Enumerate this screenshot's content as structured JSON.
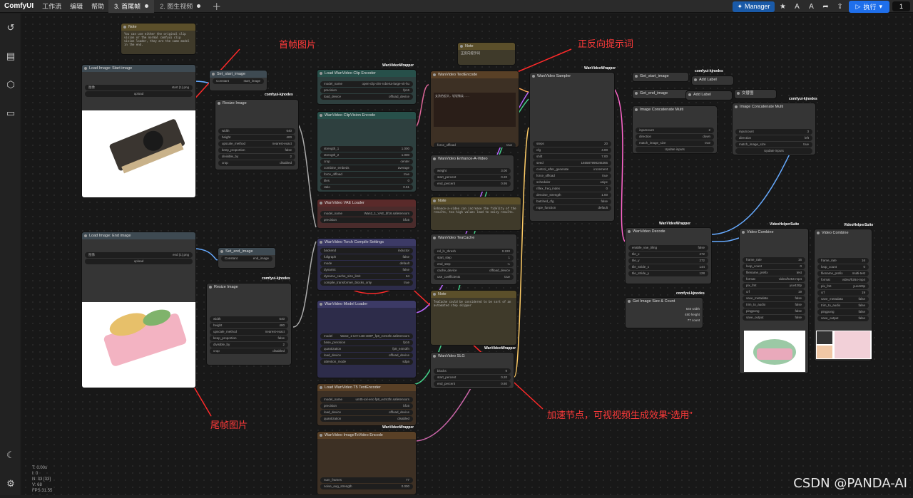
{
  "app": {
    "logo": "ComfyUI",
    "menus": [
      "工作流",
      "编辑",
      "帮助"
    ]
  },
  "tabs": [
    {
      "label": "3. 首尾帧",
      "active": true
    },
    {
      "label": "2. 图生视频",
      "active": false
    }
  ],
  "toolbar": {
    "manager": "Manager",
    "run": "执行",
    "count": "1"
  },
  "annotations": {
    "first": "首帧图片",
    "prompt": "正反向提示词",
    "last": "尾帧图片",
    "accel": "加速节点，可视视频生成效果“选用”"
  },
  "watermark": "CSDN @PANDA-AI",
  "stats": [
    "T: 0.00s",
    "I: 0",
    "N: 33 [33]",
    "V: 68",
    "FPS:31.55"
  ],
  "nodes": {
    "note1": {
      "title": "Note",
      "text": "You can use either the original clip vision or the normal comfyui clip vision loader, they are the same model in the end."
    },
    "load_start": {
      "title": "Load Image: Start image",
      "file": "start (1).png",
      "upload": "upload"
    },
    "load_end": {
      "title": "Load Image: End image",
      "file": "end (1).png",
      "upload": "upload"
    },
    "set_start": {
      "title": "Set_start_image",
      "const": "Constant",
      "val": "start_image"
    },
    "set_end": {
      "title": "Set_end_image",
      "const": "Constant",
      "val": "end_image"
    },
    "resize1": {
      "title": "Resize Image",
      "rows": [
        [
          "width",
          "640"
        ],
        [
          "height",
          "400"
        ],
        [
          "upscale_method",
          "nearest-exact"
        ],
        [
          "keep_proportion",
          "false"
        ],
        [
          "divisible_by",
          "2"
        ],
        [
          "crop",
          "disabled"
        ]
      ]
    },
    "resize2": {
      "title": "Resize Image",
      "rows": [
        [
          "width",
          "640"
        ],
        [
          "height",
          "480"
        ],
        [
          "upscale_method",
          "nearest-exact"
        ],
        [
          "keep_proportion",
          "false"
        ],
        [
          "divisible_by",
          "2"
        ],
        [
          "crop",
          "disabled"
        ]
      ]
    },
    "clip_enc": {
      "title": "Load WanVideo Clip Encoder",
      "rows": [
        [
          "model_name",
          "open-clip-xlm-roberta-large-vit-hu"
        ],
        [
          "precision",
          "fp16"
        ],
        [
          "load_device",
          "offload_device"
        ]
      ]
    },
    "clipvision": {
      "title": "WanVideo ClipVision Encode",
      "rows": [
        [
          "strength_1",
          "1.000"
        ],
        [
          "strength_2",
          "1.000"
        ],
        [
          "crop",
          "center"
        ],
        [
          "combine_embeds",
          "average"
        ],
        [
          "force_offload",
          "true"
        ],
        [
          "tiles",
          "0"
        ],
        [
          "ratio",
          "0.51"
        ]
      ]
    },
    "vae": {
      "title": "WanVideo VAE Loader",
      "rows": [
        [
          "model_name",
          "Wan2_1_VAE_bf16.safetensors"
        ],
        [
          "precision",
          "bf16"
        ]
      ]
    },
    "torch": {
      "title": "WanVideo Torch Compile Settings",
      "rows": [
        [
          "backend",
          "inductor"
        ],
        [
          "fullgraph",
          "false"
        ],
        [
          "mode",
          "default"
        ],
        [
          "dynamic",
          "false"
        ],
        [
          "dynamo_cache_size_limit",
          "64"
        ],
        [
          "compile_transformer_blocks_only",
          "true"
        ]
      ]
    },
    "model": {
      "title": "WanVideo Model Loader",
      "rows": [
        [
          "model",
          "Wan2_1-I2V-14B-480P_fp8_e4m3fn.safetensors"
        ],
        [
          "base_precision",
          "fp16"
        ],
        [
          "quantization",
          "fp8_e4m3fn"
        ],
        [
          "load_device",
          "offload_device"
        ],
        [
          "attention_mode",
          "sdpa"
        ]
      ]
    },
    "t5": {
      "title": "Load WanVideo T5 TextEncoder",
      "rows": [
        [
          "model_name",
          "umt5-xxl-enc-fp8_e4m3fn.safetensors"
        ],
        [
          "precision",
          "bf16"
        ],
        [
          "load_device",
          "offload_device"
        ],
        [
          "quantization",
          "disabled"
        ]
      ]
    },
    "i2v": {
      "title": "WanVideo ImageToVideo Encode",
      "rows": [
        [
          "num_frames",
          "77"
        ],
        [
          "noise_aug_strength",
          "0.000"
        ]
      ]
    },
    "textenc": {
      "title": "WanVideo TextEncode",
      "text": "女孩抬起头，轻轻微笑……",
      "force": "force_offload"
    },
    "note2": {
      "title": "Note",
      "text": "正反向提示词"
    },
    "enhance": {
      "title": "WanVideo Enhance-A-Video",
      "rows": [
        [
          "weight",
          "3.00"
        ],
        [
          "start_percent",
          "0.20"
        ],
        [
          "end_percent",
          "0.95"
        ]
      ]
    },
    "note3": {
      "title": "Note",
      "text": "Enhance-a-video can increase the fidelity of the results, too high values lead to noisy results."
    },
    "teacache": {
      "title": "WanVideo TeaCache",
      "rows": [
        [
          "rel_l1_thresh",
          "0.220"
        ],
        [
          "start_step",
          "1"
        ],
        [
          "end_step",
          "-1"
        ],
        [
          "cache_device",
          "offload_device"
        ],
        [
          "use_coefficients",
          "true"
        ]
      ]
    },
    "note4": {
      "title": "Note",
      "text": "TeaCache could be considered to be sort of an automated step skipper"
    },
    "slg": {
      "title": "WanVideo SLG",
      "rows": [
        [
          "blocks",
          "9"
        ],
        [
          "start_percent",
          "0.20"
        ],
        [
          "end_percent",
          "0.80"
        ]
      ]
    },
    "sampler": {
      "title": "WanVideo Sampler",
      "rows": [
        [
          "steps",
          "20"
        ],
        [
          "cfg",
          "4.00"
        ],
        [
          "shift",
          "7.00"
        ],
        [
          "seed",
          "165587998346366"
        ],
        [
          "control_after_generate",
          "increment"
        ],
        [
          "force_offload",
          "true"
        ],
        [
          "scheduler",
          "unipc"
        ],
        [
          "riflex_freq_index",
          "0"
        ],
        [
          "denoise_strength",
          "1.00"
        ],
        [
          "batched_cfg",
          "false"
        ],
        [
          "rope_function",
          "default"
        ]
      ]
    },
    "decode": {
      "title": "WanVideo Decode",
      "rows": [
        [
          "enable_vae_tiling",
          "false"
        ],
        [
          "tile_x",
          "272"
        ],
        [
          "tile_y",
          "272"
        ],
        [
          "tile_stride_x",
          "144"
        ],
        [
          "tile_stride_y",
          "128"
        ]
      ]
    },
    "getstart": {
      "title": "Get_start_image"
    },
    "getend": {
      "title": "Get_end_image"
    },
    "addlabel1": {
      "title": "Add Label"
    },
    "addlabel2": {
      "title": "Add Label"
    },
    "resizex": {
      "title": "交替图"
    },
    "concat1": {
      "title": "Image Concatenate Multi",
      "rows": [
        [
          "inputcount",
          "2"
        ],
        [
          "direction",
          "down"
        ],
        [
          "match_image_size",
          "true"
        ]
      ],
      "btn": "Update inputs"
    },
    "concat2": {
      "title": "Image Concatenate Multi",
      "rows": [
        [
          "inputcount",
          "3"
        ],
        [
          "direction",
          "left"
        ],
        [
          "match_image_size",
          "true"
        ]
      ],
      "btn": "Update inputs"
    },
    "getsize": {
      "title": "Get Image Size & Count",
      "outs": [
        "640 width",
        "480 height",
        "77 count"
      ]
    },
    "combine1": {
      "title": "Video Combine",
      "rows": [
        [
          "frame_rate",
          "16"
        ],
        [
          "loop_count",
          "0"
        ],
        [
          "filename_prefix",
          "test"
        ],
        [
          "format",
          "video/h264-mp4"
        ],
        [
          "pix_fmt",
          "yuv420p"
        ],
        [
          "crf",
          "19"
        ],
        [
          "save_metadata",
          "false"
        ],
        [
          "trim_to_audio",
          "false"
        ],
        [
          "pingpong",
          "false"
        ],
        [
          "save_output",
          "false"
        ]
      ]
    },
    "combine2": {
      "title": "Video Combine",
      "rows": [
        [
          "frame_rate",
          "16"
        ],
        [
          "loop_count",
          "0"
        ],
        [
          "filename_prefix",
          "multi-test"
        ],
        [
          "format",
          "video/h264-mp4"
        ],
        [
          "pix_fmt",
          "yuv420p"
        ],
        [
          "crf",
          "19"
        ],
        [
          "save_metadata",
          "false"
        ],
        [
          "trim_to_audio",
          "false"
        ],
        [
          "pingpong",
          "false"
        ],
        [
          "save_output",
          "false"
        ]
      ]
    }
  },
  "group_labels": {
    "wan": "WanVideoWrapper",
    "kj": "comfyui-kjnodes",
    "vhs": "VideoHelperSuite"
  }
}
